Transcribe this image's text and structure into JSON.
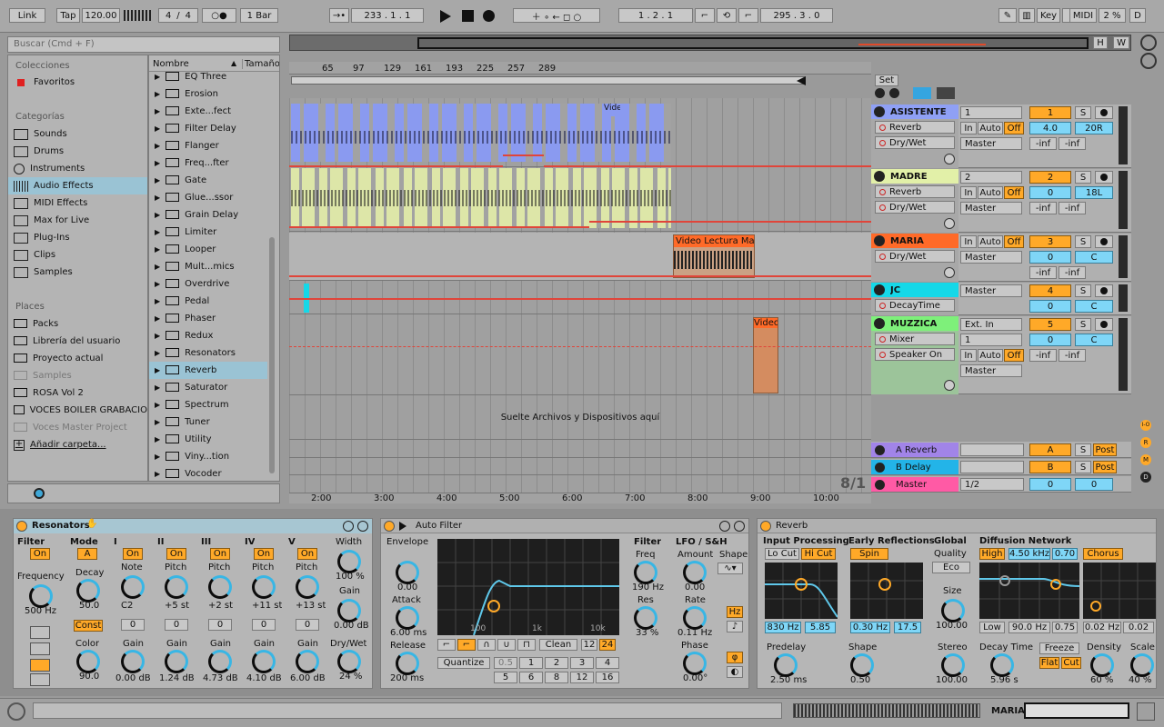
{
  "transport": {
    "link": "Link",
    "tap": "Tap",
    "tempo": "120.00",
    "sig_num": "4",
    "sig_den": "4",
    "quant": "1 Bar",
    "arr_pos": "233 .  1 .  1",
    "loop_start": "1 .  2 .  1",
    "loop_len": "295 .  3 .  0",
    "key": "Key",
    "midi": "MIDI",
    "cpu": "2 %",
    "d": "D"
  },
  "browser": {
    "search_placeholder": "Buscar (Cmd + F)",
    "collections_title": "Colecciones",
    "favoritos": "Favoritos",
    "categories_title": "Categorías",
    "categories": [
      "Sounds",
      "Drums",
      "Instruments",
      "Audio Effects",
      "MIDI Effects",
      "Max for Live",
      "Plug-Ins",
      "Clips",
      "Samples"
    ],
    "places_title": "Places",
    "places": [
      "Packs",
      "Librería del usuario",
      "Proyecto actual",
      "Samples",
      "ROSA Vol 2",
      "VOCES BOILER GRABACIO",
      "Voces Master Project",
      "Añadir carpeta..."
    ],
    "col_name": "Nombre",
    "col_size": "Tamaño",
    "items": [
      "EQ Three",
      "Erosion",
      "Exte...fect",
      "Filter Delay",
      "Flanger",
      "Freq...fter",
      "Gate",
      "Glue...ssor",
      "Grain Delay",
      "Limiter",
      "Looper",
      "Mult...mics",
      "Overdrive",
      "Pedal",
      "Phaser",
      "Redux",
      "Resonators",
      "Reverb",
      "Saturator",
      "Spectrum",
      "Tuner",
      "Utility",
      "Viny...tion",
      "Vocoder"
    ]
  },
  "arrangement": {
    "bars": [
      "65",
      "97",
      "129",
      "161",
      "193",
      "225",
      "257",
      "289"
    ],
    "times": [
      "2:00",
      "3:00",
      "4:00",
      "5:00",
      "6:00",
      "7:00",
      "8:00",
      "9:00",
      "10:00"
    ],
    "drop_hint": "Suelte Archivos y Dispositivos aquí",
    "set_label": "Set",
    "sig": "8/1",
    "hw_h": "H",
    "hw_w": "W",
    "clips": {
      "vid1": "Vide",
      "lectura": "Video Lectura Mar",
      "vid3": "Video"
    }
  },
  "tracks": [
    {
      "name": "ASISTENTE",
      "color": "#8fa0f5",
      "dev1": "Reverb",
      "dev2": "Dry/Wet",
      "input": "1",
      "output": "Master",
      "num": "1",
      "vol": "4.0",
      "pan": "20R",
      "in": "In",
      "auto": "Auto",
      "off": "Off",
      "inf1": "-inf",
      "inf2": "-inf",
      "s": "S"
    },
    {
      "name": "MADRE",
      "color": "#e2f0a8",
      "dev1": "Reverb",
      "dev2": "Dry/Wet",
      "input": "2",
      "output": "Master",
      "num": "2",
      "vol": "0",
      "pan": "18L",
      "in": "In",
      "auto": "Auto",
      "off": "Off",
      "inf1": "-inf",
      "inf2": "-inf",
      "s": "S"
    },
    {
      "name": "MARIA",
      "color": "#ff6a28",
      "dev1": "Dry/Wet",
      "output": "Master",
      "num": "3",
      "vol": "0",
      "pan": "C",
      "in": "In",
      "auto": "Auto",
      "off": "Off",
      "inf1": "-inf",
      "inf2": "-inf",
      "s": "S"
    },
    {
      "name": "JC",
      "color": "#15d8e8",
      "dev1": "DecayTime",
      "output": "Master",
      "num": "4",
      "vol": "0",
      "pan": "C",
      "s": "S"
    },
    {
      "name": "MUZZICA",
      "color": "#7ef07a",
      "dev1": "Mixer",
      "dev2": "Speaker On",
      "input": "Ext. In",
      "input2": "1",
      "output": "Master",
      "num": "5",
      "vol": "0",
      "pan": "C",
      "in": "In",
      "auto": "Auto",
      "off": "Off",
      "inf1": "-inf",
      "inf2": "-inf",
      "s": "S"
    }
  ],
  "returns": [
    {
      "name": "A Reverb",
      "color": "#a184e8",
      "letter": "A",
      "s": "S",
      "post": "Post"
    },
    {
      "name": "B Delay",
      "color": "#23b4e8",
      "letter": "B",
      "s": "S",
      "post": "Post"
    },
    {
      "name": "Master",
      "color": "#ff5aa5",
      "io": "1/2",
      "vol": "0",
      "pan": "0"
    }
  ],
  "mixer_side": [
    "I-O",
    "R",
    "M",
    "D"
  ],
  "resonators": {
    "title": "Resonators",
    "filter": "Filter",
    "on": "On",
    "mode": "Mode",
    "mode_val": "A",
    "freq_label": "Frequency",
    "freq_val": "500 Hz",
    "decay": "Decay",
    "decay_val": "50.0",
    "const": "Const",
    "color": "Color",
    "color_val": "90.0",
    "cols": [
      {
        "n": "I",
        "note": "Note",
        "nv": "C2",
        "g": "0",
        "gv": "0.00 dB"
      },
      {
        "n": "II",
        "note": "Pitch",
        "nv": "+5 st",
        "g": "0",
        "gv": "1.24 dB"
      },
      {
        "n": "III",
        "note": "Pitch",
        "nv": "+2 st",
        "g": "0",
        "gv": "4.73 dB"
      },
      {
        "n": "IV",
        "note": "Pitch",
        "nv": "+11 st",
        "g": "0",
        "gv": "4.10 dB"
      },
      {
        "n": "V",
        "note": "Pitch",
        "nv": "+13 st",
        "g": "0",
        "gv": "6.00 dB"
      }
    ],
    "gain": "Gain",
    "width": "Width",
    "width_val": "100 %",
    "gain_r": "Gain",
    "gain_r_val": "0.00 dB",
    "drywet": "Dry/Wet",
    "drywet_val": "24 %"
  },
  "autofilter": {
    "title": "Auto Filter",
    "envelope": "Envelope",
    "env_val": "0.00",
    "attack": "Attack",
    "attack_val": "6.00 ms",
    "release": "Release",
    "release_val": "200 ms",
    "filter": "Filter",
    "freq": "Freq",
    "freq_val": "190 Hz",
    "res": "Res",
    "res_val": "33 %",
    "lfo": "LFO / S&H",
    "amount": "Amount",
    "amount_val": "0.00",
    "shape": "Shape",
    "rate": "Rate",
    "rate_val": "0.11 Hz",
    "phase": "Phase",
    "phase_val": "0.00°",
    "hz": "Hz",
    "clean": "Clean",
    "n12": "12",
    "n24": "24",
    "quantize": "Quantize",
    "q": [
      "0.5",
      "1",
      "2",
      "3",
      "4",
      "5",
      "6",
      "8",
      "12",
      "16"
    ],
    "g100": "100",
    "g1k": "1k",
    "g10k": "10k"
  },
  "reverb": {
    "title": "Reverb",
    "input": "Input Processing",
    "locut": "Lo Cut",
    "hicut": "Hi Cut",
    "lo_val": "830 Hz",
    "hi_val": "5.85",
    "predelay": "Predelay",
    "predelay_val": "2.50 ms",
    "early": "Early Reflections",
    "spin": "Spin",
    "er1": "0.30 Hz",
    "er2": "17.5",
    "shape": "Shape",
    "shape_val": "0.50",
    "global": "Global",
    "quality": "Quality",
    "quality_val": "Eco",
    "size": "Size",
    "size_val": "100.00",
    "stereo": "Stereo",
    "stereo_val": "100.00",
    "diff": "Diffusion Network",
    "high": "High",
    "hv": "4.50 kHz",
    "hv2": "0.70",
    "chorus": "Chorus",
    "low": "Low",
    "lv": "90.0 Hz",
    "lv2": "0.75",
    "cv1": "0.02 Hz",
    "cv2": "0.02",
    "decay": "Decay Time",
    "decay_val": "5.96 s",
    "freeze": "Freeze",
    "flat": "Flat",
    "cut": "Cut",
    "density": "Density",
    "density_val": "60 %",
    "scale": "Scale",
    "scale_val": "40 %"
  },
  "status": {
    "track": "MARIA"
  }
}
